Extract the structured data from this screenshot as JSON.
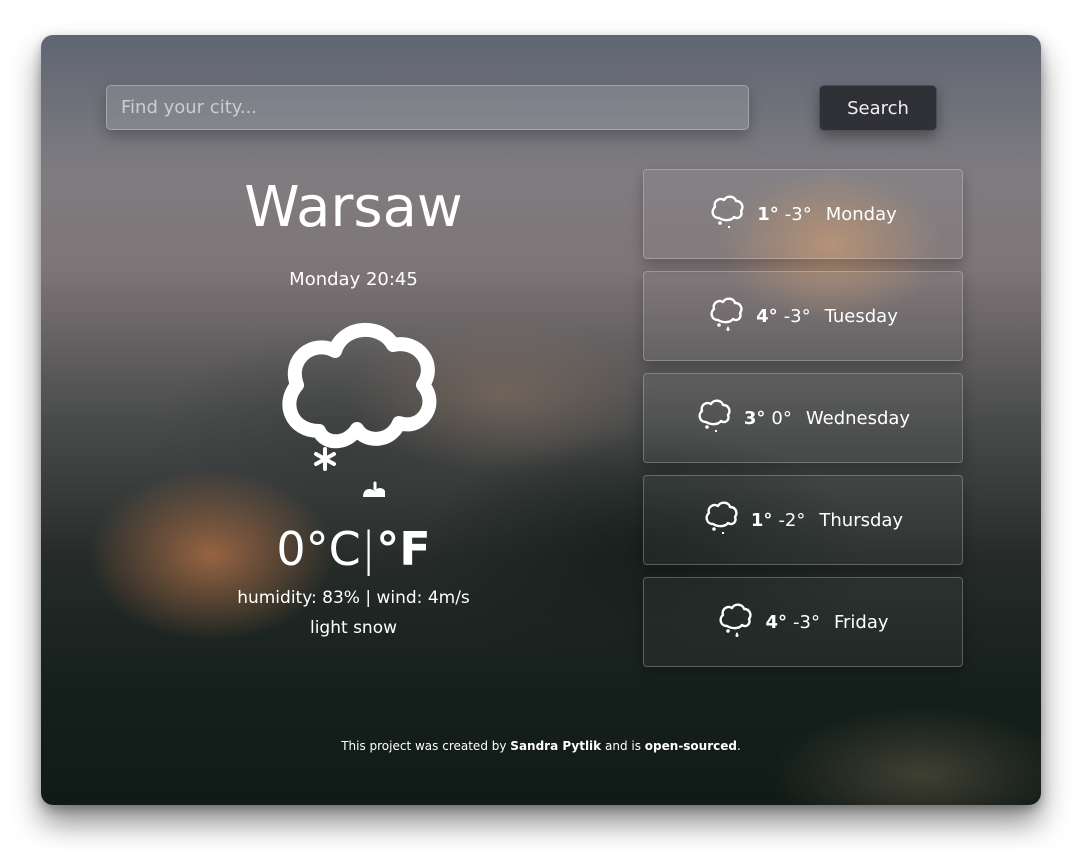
{
  "search": {
    "placeholder": "Find your city...",
    "button_label": "Search"
  },
  "current": {
    "city": "Warsaw",
    "datetime": "Monday 20:45",
    "icon": "snow-cloud-icon",
    "temperature": "0",
    "unit_c": "°C",
    "separator": "|",
    "unit_f": "°F",
    "details": "humidity: 83% | wind: 4m/s",
    "description": "light snow"
  },
  "forecast": [
    {
      "icon": "cloud-rain-icon",
      "high": "1°",
      "low": "-3°",
      "day": "Monday"
    },
    {
      "icon": "cloud-rain-icon",
      "high": "4°",
      "low": "-3°",
      "day": "Tuesday"
    },
    {
      "icon": "cloud-rain-icon",
      "high": "3°",
      "low": "0°",
      "day": "Wednesday"
    },
    {
      "icon": "cloud-rain-icon",
      "high": "1°",
      "low": "-2°",
      "day": "Thursday"
    },
    {
      "icon": "cloud-rain-icon",
      "high": "4°",
      "low": "-3°",
      "day": "Friday"
    }
  ],
  "footer": {
    "prefix": "This project was created by",
    "author": "Sandra Pytlik",
    "middle": "and is",
    "link": "open-sourced",
    "suffix": "."
  }
}
